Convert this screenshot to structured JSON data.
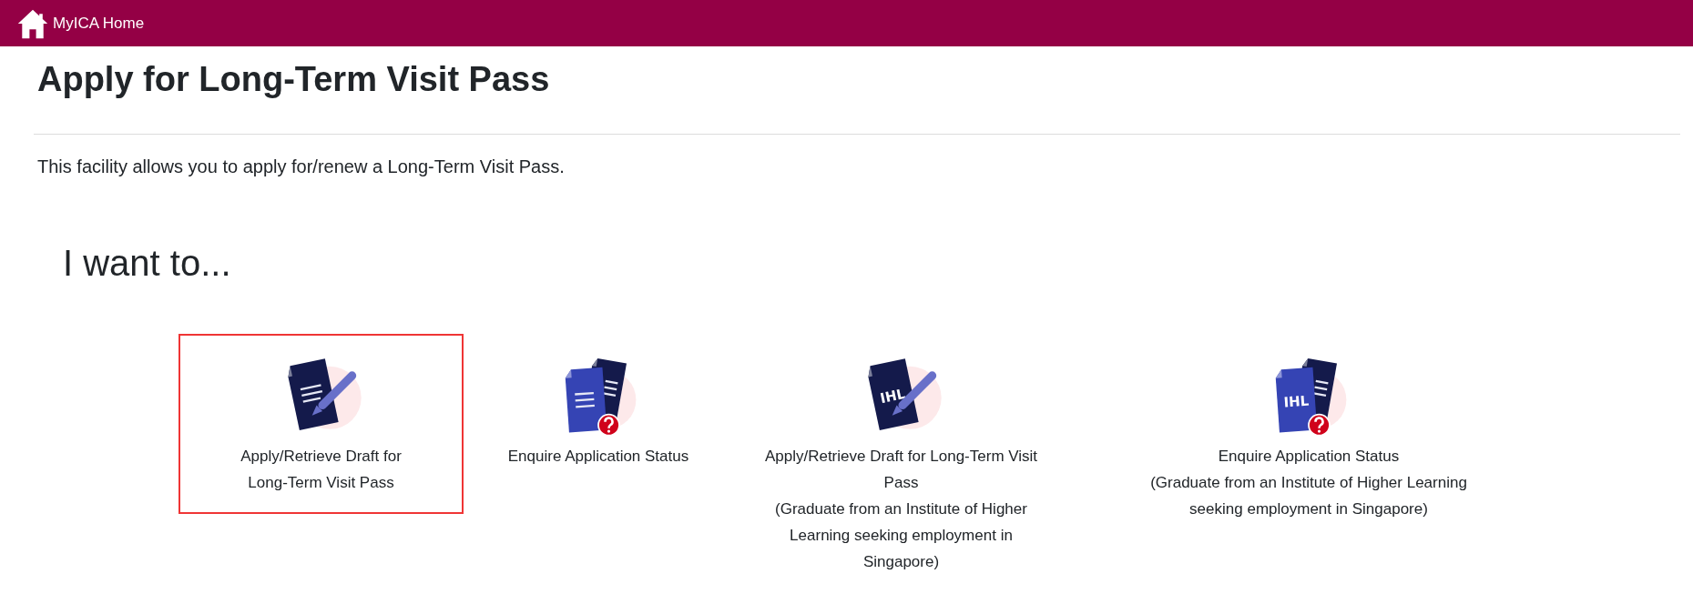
{
  "header": {
    "home_link": "MyICA Home"
  },
  "page": {
    "title": "Apply for Long-Term Visit Pass",
    "description": "This facility allows you to apply for/renew a Long-Term Visit Pass.",
    "prompt": "I want to..."
  },
  "options": [
    {
      "kind": "apply",
      "title": "Apply/Retrieve Draft for Long-Term Visit Pass",
      "selected": true
    },
    {
      "kind": "enquire",
      "title": "Enquire Application Status",
      "selected": false
    },
    {
      "kind": "apply",
      "icon_text": "IHL",
      "title": "Apply/Retrieve Draft for Long-Term Visit Pass",
      "note": "(Graduate from an Institute of Higher Learning seeking employment in Singapore)",
      "selected": false
    },
    {
      "kind": "enquire",
      "icon_text": "IHL",
      "title": "Enquire Application Status",
      "note": "(Graduate from an Institute of Higher Learning seeking employment in Singapore)",
      "selected": false
    }
  ]
}
